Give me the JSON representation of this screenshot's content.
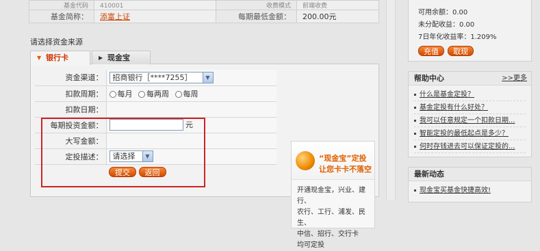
{
  "fund_info": {
    "row0_label": "基金代码",
    "row0_value": "410001",
    "row0_label2": "收费模式",
    "row0_value2": "前端收费",
    "name_label": "基金简称：",
    "name_value": "添富上证",
    "min_label": "每期最低金额：",
    "min_value": "200.00元"
  },
  "section_title": "请选择资金来源",
  "tabs": [
    {
      "label": "银行卡",
      "active": true
    },
    {
      "label": "现金宝",
      "active": false
    }
  ],
  "form": {
    "channel_label": "资金渠道：",
    "channel_value": "招商银行［****7255］",
    "period_label": "扣款周期：",
    "period_options": [
      "每月",
      "每两周",
      "每周"
    ],
    "date_label": "扣款日期：",
    "amount_label": "每期投资金额：",
    "amount_value": "",
    "amount_unit": "元",
    "caps_label": "大写金额：",
    "desc_label": "定投描述：",
    "desc_value": "请选择",
    "submit_label": "提交",
    "back_label": "返回"
  },
  "promo": {
    "title_line1": "“现金宝”定投",
    "title_line2": "让您卡卡不落空",
    "body_lines": [
      "开通现金宝，兴业、建行、",
      "农行、工行、浦发、民生、",
      "中信、招行、交行卡",
      "均可定投"
    ]
  },
  "account": {
    "available": "可用余额：0.00",
    "undistributed": "未分配收益：0.00",
    "annualized": "7日年化收益率：1.209%",
    "recharge_label": "充值",
    "withdraw_label": "取现"
  },
  "help": {
    "title": "帮助中心",
    "more": ">>更多",
    "items": [
      "什么是基金定投？",
      "基金定投有什么好处？",
      "我可以任意规定一个扣款日期...",
      "智能定投的最低起点是多少？",
      "何时存钱进去可以保证定投的..."
    ]
  },
  "news": {
    "title": "最新动态",
    "items": [
      "现金宝买基金快捷高效!"
    ]
  },
  "colors": {
    "accent": "#e06000",
    "highlight_border": "#cc2222"
  }
}
